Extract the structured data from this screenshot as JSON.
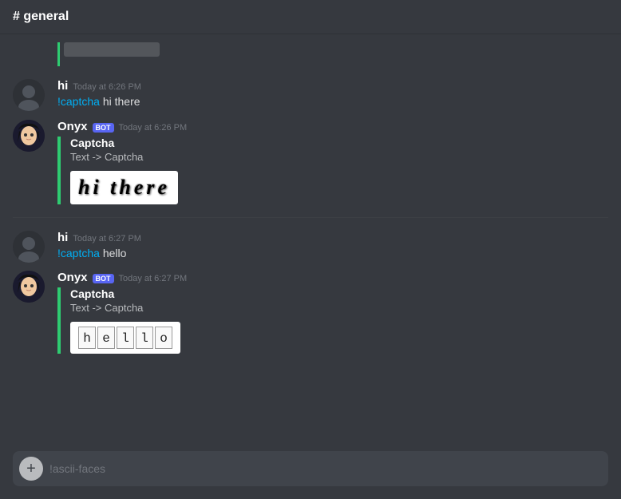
{
  "channel": {
    "name": "# general"
  },
  "messages": [
    {
      "id": "msg1",
      "type": "human",
      "avatar_type": "human",
      "author": "hi",
      "timestamp": "Today at 6:26 PM",
      "content": "!captcha hi there",
      "command_word": "!captcha ",
      "command_args": "hi there"
    },
    {
      "id": "msg2",
      "type": "bot",
      "avatar_type": "bot",
      "author": "Onyx",
      "is_bot": true,
      "timestamp": "Today at 6:26 PM",
      "embed": {
        "title": "Captcha",
        "desc": "Text -> Captcha",
        "image_text": "hi there",
        "type": "style1"
      }
    },
    {
      "id": "msg3",
      "type": "human",
      "avatar_type": "human",
      "author": "hi",
      "timestamp": "Today at 6:27 PM",
      "content": "!captcha hello",
      "command_word": "!captcha ",
      "command_args": "hello"
    },
    {
      "id": "msg4",
      "type": "bot",
      "avatar_type": "bot",
      "author": "Onyx",
      "is_bot": true,
      "timestamp": "Today at 6:27 PM",
      "embed": {
        "title": "Captcha",
        "desc": "Text -> Captcha",
        "image_text": "hello",
        "type": "style2",
        "letters": [
          "h",
          "e",
          "l",
          "l",
          "o"
        ]
      }
    }
  ],
  "input": {
    "placeholder": "!ascii-faces",
    "add_button_label": "+"
  },
  "bot_badge_label": "BOT"
}
